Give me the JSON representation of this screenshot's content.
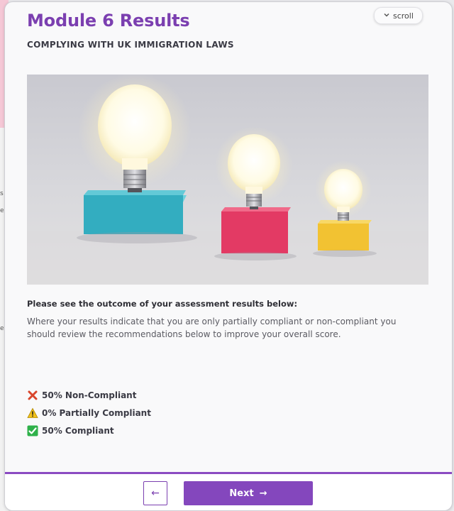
{
  "module": {
    "title": "Module 6 Results",
    "subtitle": "COMPLYING WITH UK IMMIGRATION LAWS",
    "scroll_label": "scroll"
  },
  "hero_image": {
    "description_name": "light-bulbs-on-colored-blocks"
  },
  "assessment": {
    "heading": "Please see the outcome of your assessment results below:",
    "body": "Where your results indicate that you are only partially compliant or non-compliant you should review the recommendations below to improve your overall score."
  },
  "results": [
    {
      "icon": "cross-mark-icon",
      "label": "50% Non-Compliant",
      "color": "#d9452b"
    },
    {
      "icon": "warning-icon",
      "label": "0% Partially Compliant",
      "color": "#f2c21b"
    },
    {
      "icon": "check-mark-icon",
      "label": "50% Compliant",
      "color": "#2fb14a"
    }
  ],
  "navigation": {
    "back_icon": "arrow-left-icon",
    "back_symbol": "←",
    "next_label": "Next",
    "next_symbol": "→"
  },
  "colors": {
    "accent": "#7b3fb0",
    "button": "#8447bd"
  }
}
